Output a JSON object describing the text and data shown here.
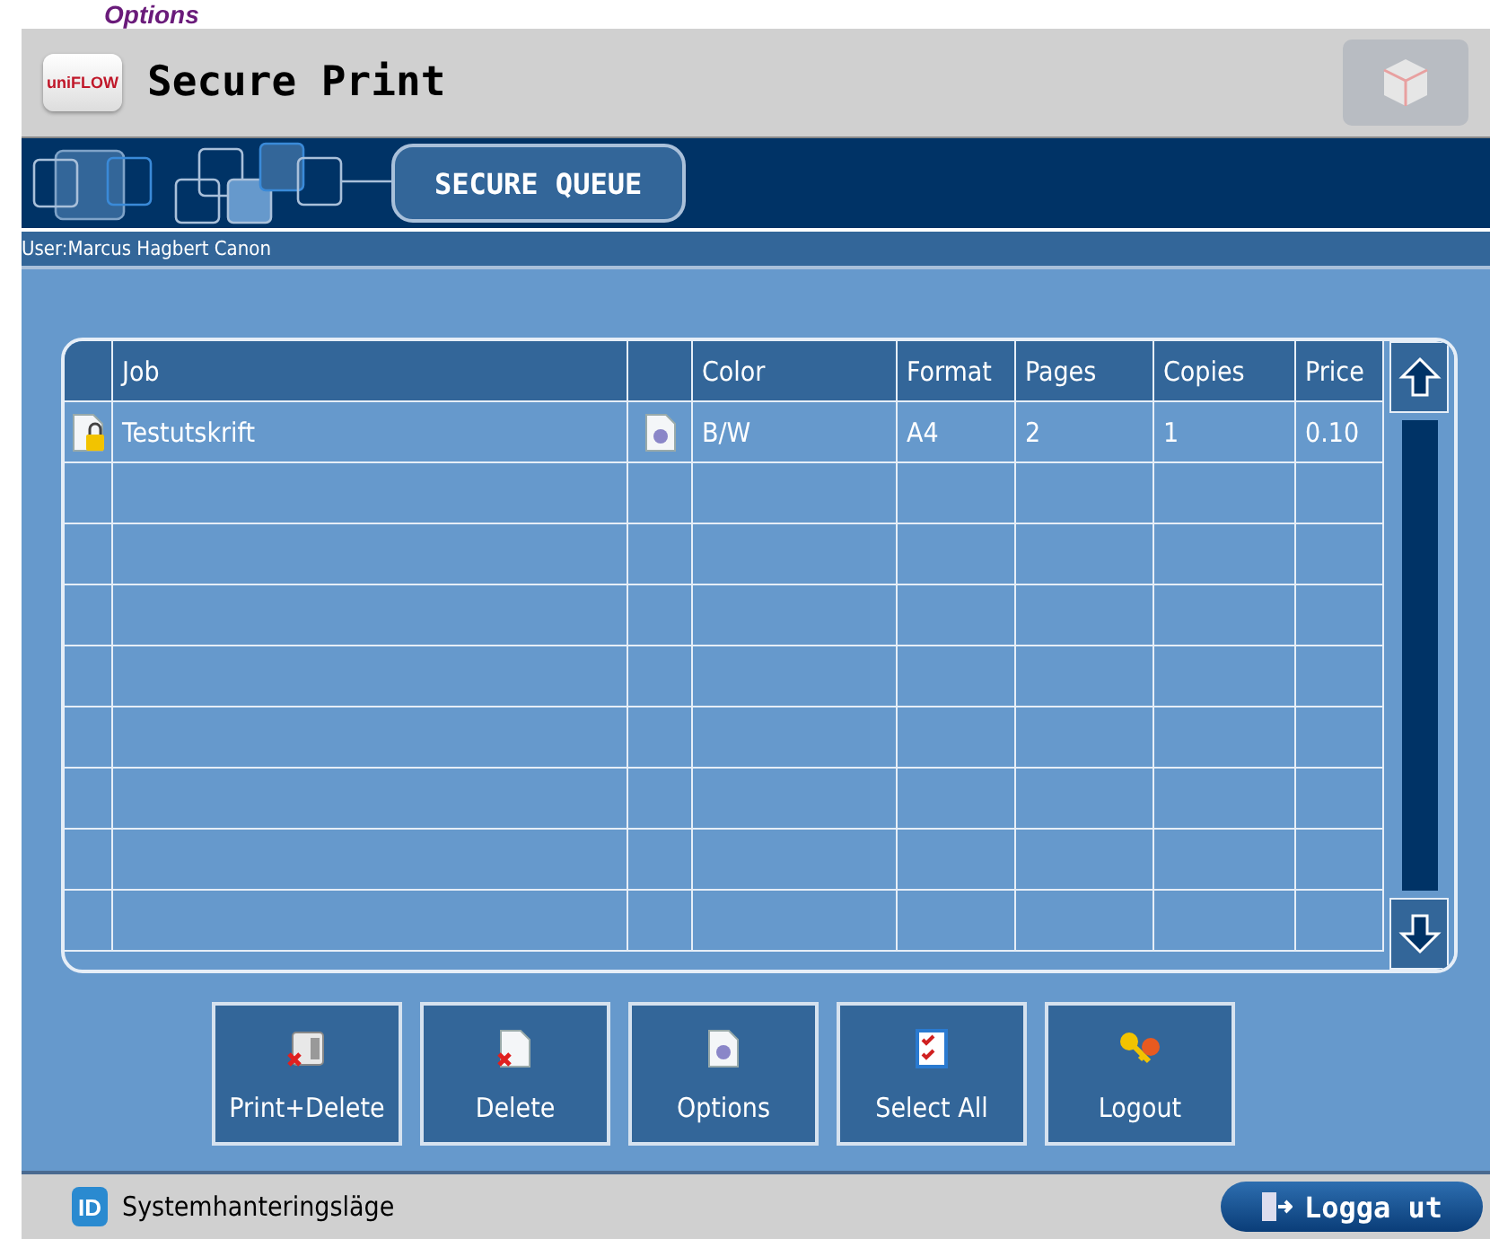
{
  "doc_heading": "Options",
  "header": {
    "logo": "uniFLOW",
    "title": "Secure Print"
  },
  "breadcrumb": {
    "label": "SECURE QUEUE"
  },
  "user": "User:Marcus Hagbert Canon",
  "table": {
    "columns": [
      "Job",
      "Color",
      "Format",
      "Pages",
      "Copies",
      "Price"
    ],
    "rows": [
      {
        "job": "Testutskrift",
        "color_mode": "B/W",
        "format": "A4",
        "pages": "2",
        "copies": "1",
        "price": "0.10"
      }
    ]
  },
  "actions": [
    {
      "kind": "print-delete",
      "label": "Print+Delete"
    },
    {
      "kind": "delete",
      "label": "Delete"
    },
    {
      "kind": "options",
      "label": "Options"
    },
    {
      "kind": "select-all",
      "label": "Select All"
    },
    {
      "kind": "logout",
      "label": "Logout"
    }
  ],
  "footer": {
    "mode": "Systemhanteringsläge",
    "id_badge": "ID",
    "logout": "Logga ut"
  }
}
